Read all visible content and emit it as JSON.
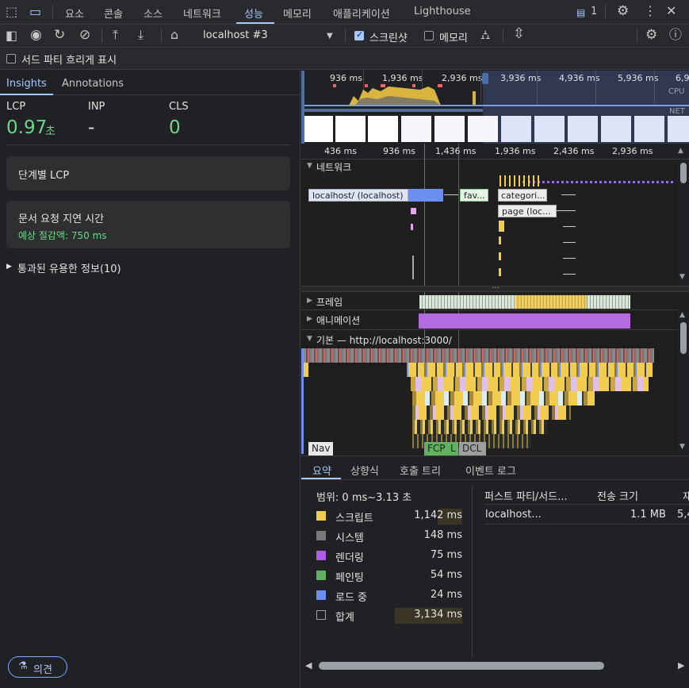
{
  "topbar": {
    "tabs": [
      "요소",
      "콘솔",
      "소스",
      "네트워크",
      "성능",
      "메모리",
      "애플리케이션",
      "Lighthouse"
    ],
    "active_tab": "성능",
    "badge_count": "1"
  },
  "toolbar": {
    "recording_select": "localhost #3",
    "screenshot_label": "스크린샷",
    "memory_label": "메모리"
  },
  "toolbar3": {
    "third_party_label": "서드 파티 흐리게 표시"
  },
  "left": {
    "tabs": [
      "Insights",
      "Annotations"
    ],
    "metrics": [
      {
        "label": "LCP",
        "value": "0.97",
        "unit": "초",
        "color": "#6dd58c"
      },
      {
        "label": "INP",
        "value": "-",
        "unit": "",
        "color": "#e3e3e3"
      },
      {
        "label": "CLS",
        "value": "0",
        "unit": "",
        "color": "#6dd58c"
      }
    ],
    "card1_title": "단계별 LCP",
    "card2_title": "문서 요청 지연 시간",
    "card2_sub": "예상 절감액: 750 ms",
    "passed": "통과된 유용한 정보(10)",
    "feedback": "의견"
  },
  "overview": {
    "ticks": [
      "936 ms",
      "1,936 ms",
      "2,936 ms",
      "3,936 ms",
      "4,936 ms",
      "5,936 ms",
      "6,9"
    ],
    "cpu_label": "CPU",
    "net_label": "NET"
  },
  "timeline": {
    "ticks": [
      "436 ms",
      "936 ms",
      "1,436 ms",
      "1,936 ms",
      "2,436 ms",
      "2,936 ms"
    ],
    "network_label": "네트워크",
    "net_items": [
      "localhost/ (localhost)",
      "fav...",
      "categori...",
      "page (loc..."
    ],
    "frames_label": "프레임",
    "animation_label": "애니메이션",
    "main_label": "기본 — http://localhost:3000/",
    "markers": [
      "Nav",
      "FCP",
      "L",
      "DCL"
    ]
  },
  "summary": {
    "tabs": [
      "요약",
      "상향식",
      "호출 트리",
      "이벤트 로그"
    ],
    "range": "범위: 0 ms~3.13 초",
    "rows": [
      {
        "name": "스크립트",
        "value": "1,142 ms",
        "color": "#f2cc4f",
        "fill": 0.36
      },
      {
        "name": "시스템",
        "value": "148 ms",
        "color": "#797979",
        "fill": 0
      },
      {
        "name": "렌더링",
        "value": "75 ms",
        "color": "#af5be8",
        "fill": 0
      },
      {
        "name": "페인팅",
        "value": "54 ms",
        "color": "#5fb35f",
        "fill": 0
      },
      {
        "name": "로드 중",
        "value": "24 ms",
        "color": "#6c8ef0",
        "fill": 0
      },
      {
        "name": "합계",
        "value": "3,134 ms",
        "color": "transparent",
        "fill": 1
      }
    ],
    "col_headers": [
      "퍼스트 파티/서드...",
      "전송 크기",
      "재"
    ],
    "party_row": {
      "name": "localhost...",
      "size": "1.1 MB",
      "extra": "5,4"
    }
  }
}
